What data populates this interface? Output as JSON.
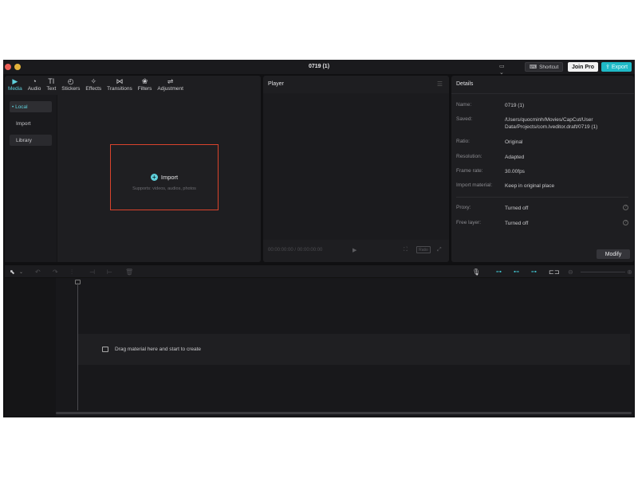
{
  "window": {
    "title": "0719 (1)"
  },
  "titlebar": {
    "layout_icon": "layout-icon",
    "shortcut_label": "Shortcut",
    "joinpro_label": "Join Pro",
    "export_label": "Export"
  },
  "media": {
    "tabs": [
      {
        "label": "Media",
        "icon": "▶"
      },
      {
        "label": "Audio",
        "icon": "◔"
      },
      {
        "label": "Text",
        "icon": "TI"
      },
      {
        "label": "Stickers",
        "icon": "◴"
      },
      {
        "label": "Effects",
        "icon": "✧"
      },
      {
        "label": "Transitions",
        "icon": "⋈"
      },
      {
        "label": "Filters",
        "icon": "❀"
      },
      {
        "label": "Adjustment",
        "icon": "⇌"
      }
    ],
    "sidebar": [
      {
        "label": "• Local"
      },
      {
        "label": "Import"
      },
      {
        "label": "Library"
      }
    ],
    "import": {
      "label": "Import",
      "subtitle": "Supports: videos, audios, photos"
    }
  },
  "player": {
    "title": "Player",
    "timecode": "00:00:00:00 / 00:00:00:00",
    "ratio_label": "Ratio"
  },
  "details": {
    "title": "Details",
    "rows": [
      {
        "key": "Name:",
        "value": "0719 (1)"
      },
      {
        "key": "Saved:",
        "value": "/Users/quocminh/Movies/CapCut/User Data/Projects/com.lveditor.draft/0719 (1)"
      },
      {
        "key": "Ratio:",
        "value": "Original"
      },
      {
        "key": "Resolution:",
        "value": "Adapted"
      },
      {
        "key": "Frame rate:",
        "value": "30.00fps"
      },
      {
        "key": "Import material:",
        "value": "Keep in original place"
      },
      {
        "key": "Proxy:",
        "value": "Turned off"
      },
      {
        "key": "Free layer:",
        "value": "Turned off"
      }
    ],
    "modify_label": "Modify"
  },
  "timeline": {
    "drop_text": "Drag material here and start to create"
  }
}
